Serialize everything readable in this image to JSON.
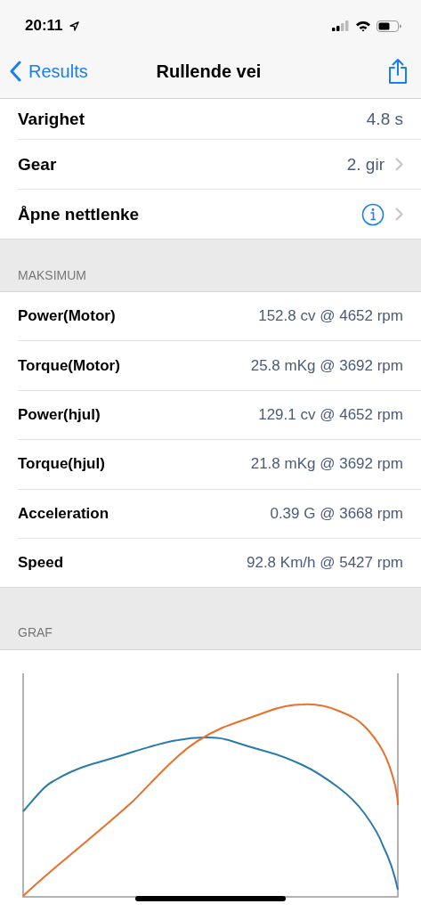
{
  "status_bar": {
    "time": "20:11"
  },
  "nav": {
    "back_label": "Results",
    "title": "Rullende vei"
  },
  "details": [
    {
      "label": "Varighet",
      "value": "4.8 s",
      "kind": "plain"
    },
    {
      "label": "Gear",
      "value": "2. gir",
      "kind": "chevron"
    },
    {
      "label": "Åpne nettlenke",
      "kind": "info"
    }
  ],
  "maksimum": {
    "header": "MAKSIMUM",
    "rows": [
      {
        "label": "Power(Motor)",
        "value": "152.8 cv @ 4652 rpm"
      },
      {
        "label": "Torque(Motor)",
        "value": "25.8 mKg @ 3692 rpm"
      },
      {
        "label": "Power(hjul)",
        "value": "129.1 cv @ 4652 rpm"
      },
      {
        "label": "Torque(hjul)",
        "value": "21.8 mKg @ 3692 rpm"
      },
      {
        "label": "Acceleration",
        "value": "0.39 G @ 3668 rpm"
      },
      {
        "label": "Speed",
        "value": "92.8 Km/h @ 5427 rpm"
      }
    ]
  },
  "graf": {
    "header": "GRAF"
  }
}
